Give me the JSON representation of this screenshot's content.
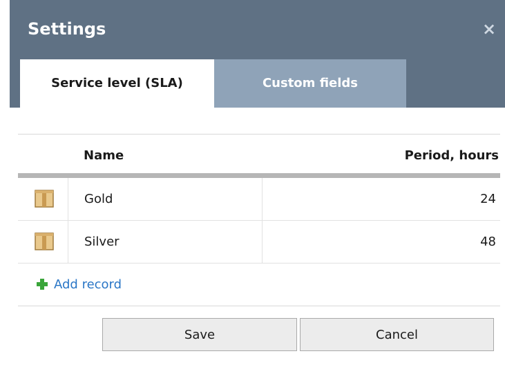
{
  "dialog": {
    "title": "Settings",
    "close_glyph": "×"
  },
  "tabs": [
    {
      "label": "Service level (SLA)",
      "active": true
    },
    {
      "label": "Custom fields",
      "active": false
    }
  ],
  "grid": {
    "columns": {
      "name": "Name",
      "period": "Period, hours"
    },
    "rows": [
      {
        "icon": "box-icon",
        "name": "Gold",
        "period": "24"
      },
      {
        "icon": "box-icon",
        "name": "Silver",
        "period": "48"
      }
    ],
    "add_record": {
      "icon": "plus-icon",
      "label": "Add record"
    }
  },
  "buttons": {
    "save": "Save",
    "cancel": "Cancel"
  },
  "colors": {
    "titlebar": "#5f7184",
    "active_tab": "#ffffff",
    "inactive_tab": "#8fa3b8",
    "link": "#2a76c6",
    "plus": "#3aa53a"
  }
}
